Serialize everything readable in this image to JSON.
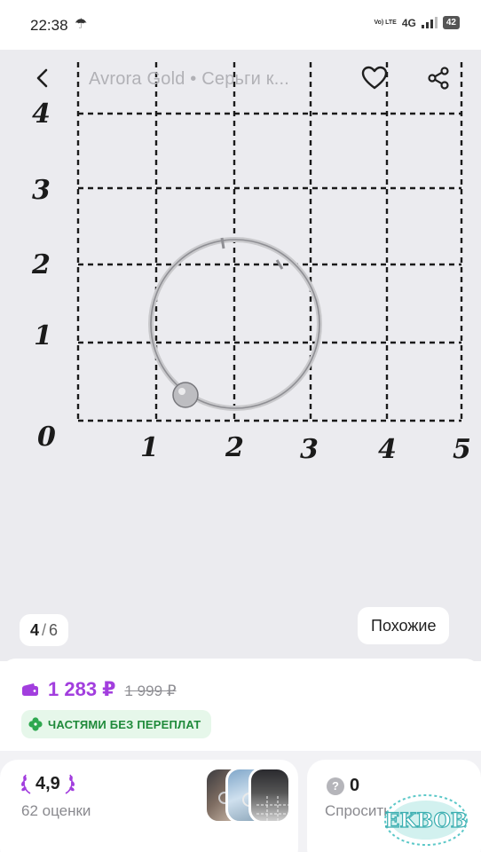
{
  "status_bar": {
    "time": "22:38",
    "volte_label": "Vo) LTE",
    "network": "4G",
    "battery": "42"
  },
  "topbar": {
    "title": "Avrora Gold • Серьги к...",
    "back_icon": "chevron-left-icon",
    "favorite_icon": "heart-outline-icon",
    "share_icon": "share-icon"
  },
  "gallery": {
    "current": "4",
    "separator": "/",
    "total": "6",
    "similar_label": "Похожие",
    "photo_axis_x": [
      "0",
      "1",
      "2",
      "3",
      "4",
      "5"
    ],
    "photo_axis_y": [
      "1",
      "2",
      "3",
      "4"
    ]
  },
  "price": {
    "current": "1 283 ₽",
    "old": "1 999 ₽",
    "accent_color": "#a23ede"
  },
  "installments": {
    "label": "ЧАСТЯМИ БЕЗ ПЕРЕПЛАТ",
    "color": "#1f8a3a"
  },
  "reviews": {
    "rating": "4,9",
    "count_label": "62 оценки"
  },
  "questions": {
    "count": "0",
    "ask_label": "Спросить"
  },
  "watermark": {
    "text": "EKBOB"
  }
}
